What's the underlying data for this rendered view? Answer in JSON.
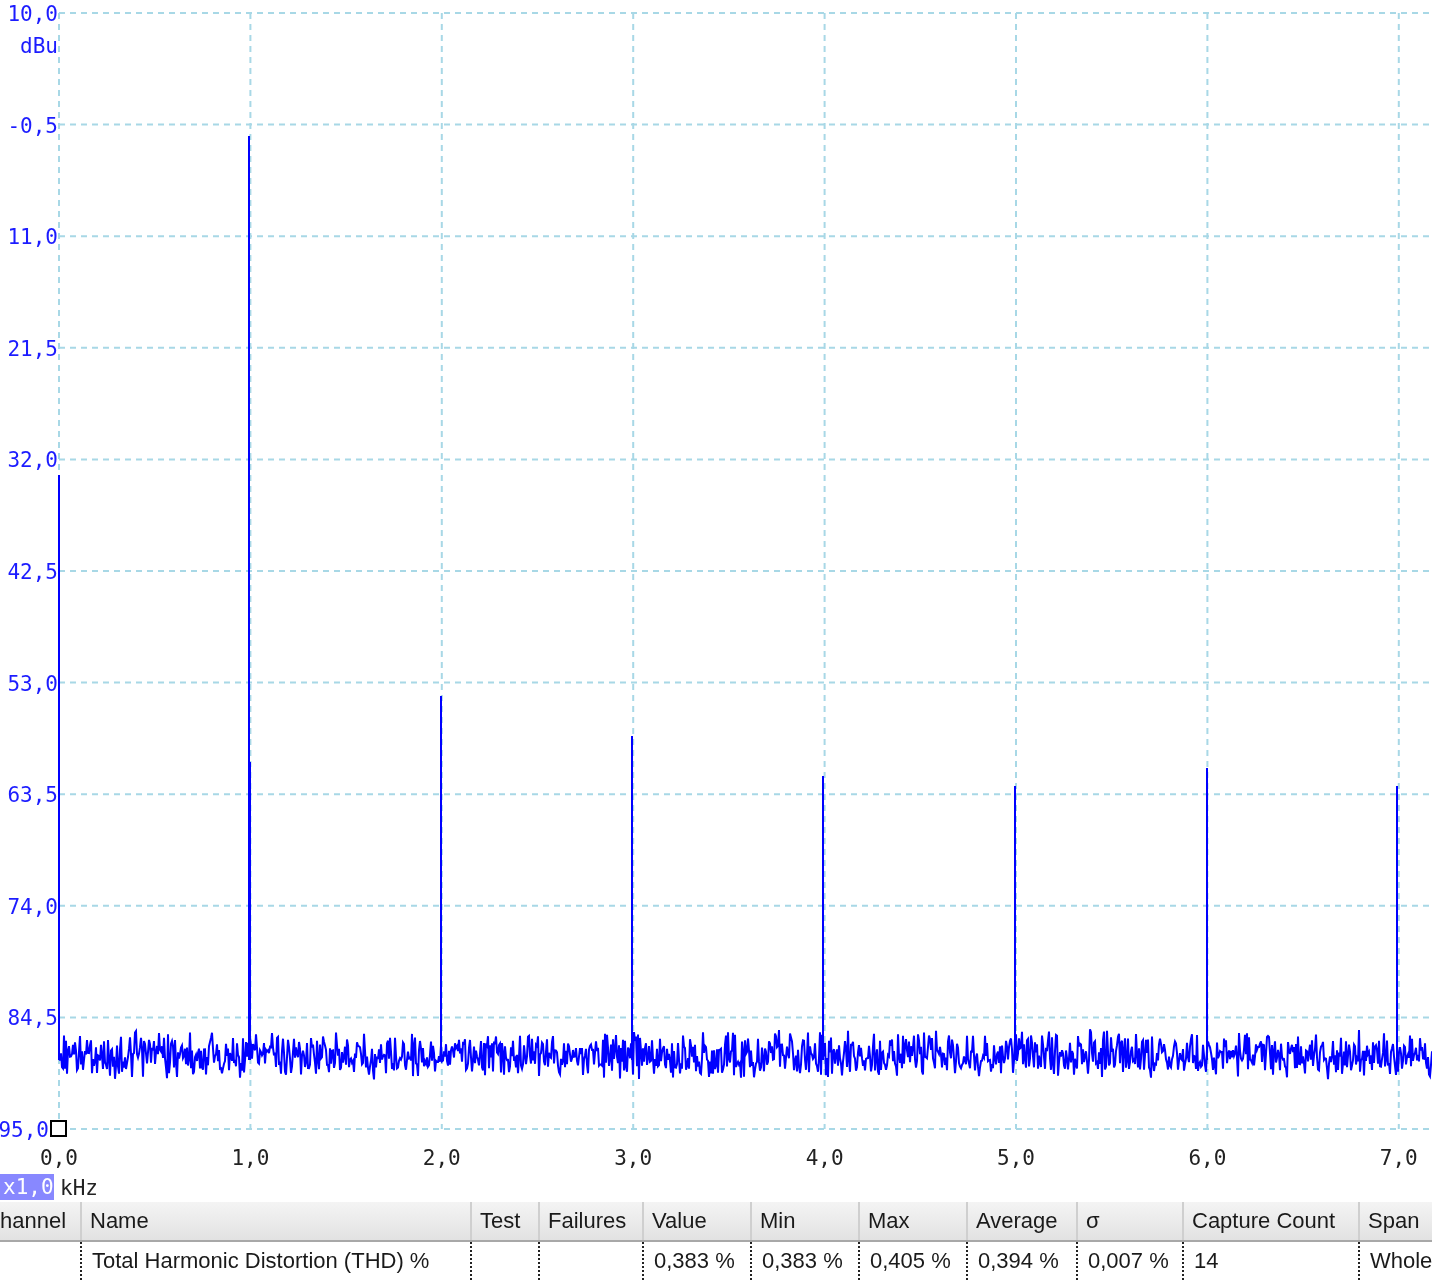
{
  "spectrum": {
    "y_axis": {
      "unit": "dBu",
      "ticks": [
        "10,0",
        "-0,5",
        "11,0",
        "21,5",
        "32,0",
        "42,5",
        "53,0",
        "63,5",
        "74,0",
        "84,5",
        "95,0"
      ]
    },
    "x_axis": {
      "unit": "kHz",
      "zoom": "x1,0",
      "ticks": [
        "0,0",
        "1,0",
        "2,0",
        "3,0",
        "4,0",
        "5,0",
        "6,0",
        "7,0"
      ]
    }
  },
  "table": {
    "columns": [
      "hannel",
      "Name",
      "Test",
      "Failures",
      "Value",
      "Min",
      "Max",
      "Average",
      "σ",
      "Capture Count",
      "Span"
    ],
    "rows": [
      {
        "cells": [
          "",
          "Total Harmonic Distortion (THD) %",
          "",
          "",
          "0,383 %",
          "0,383 %",
          "0,405 %",
          "0,394 %",
          "0,007 %",
          "14",
          "Whole"
        ]
      }
    ]
  }
}
